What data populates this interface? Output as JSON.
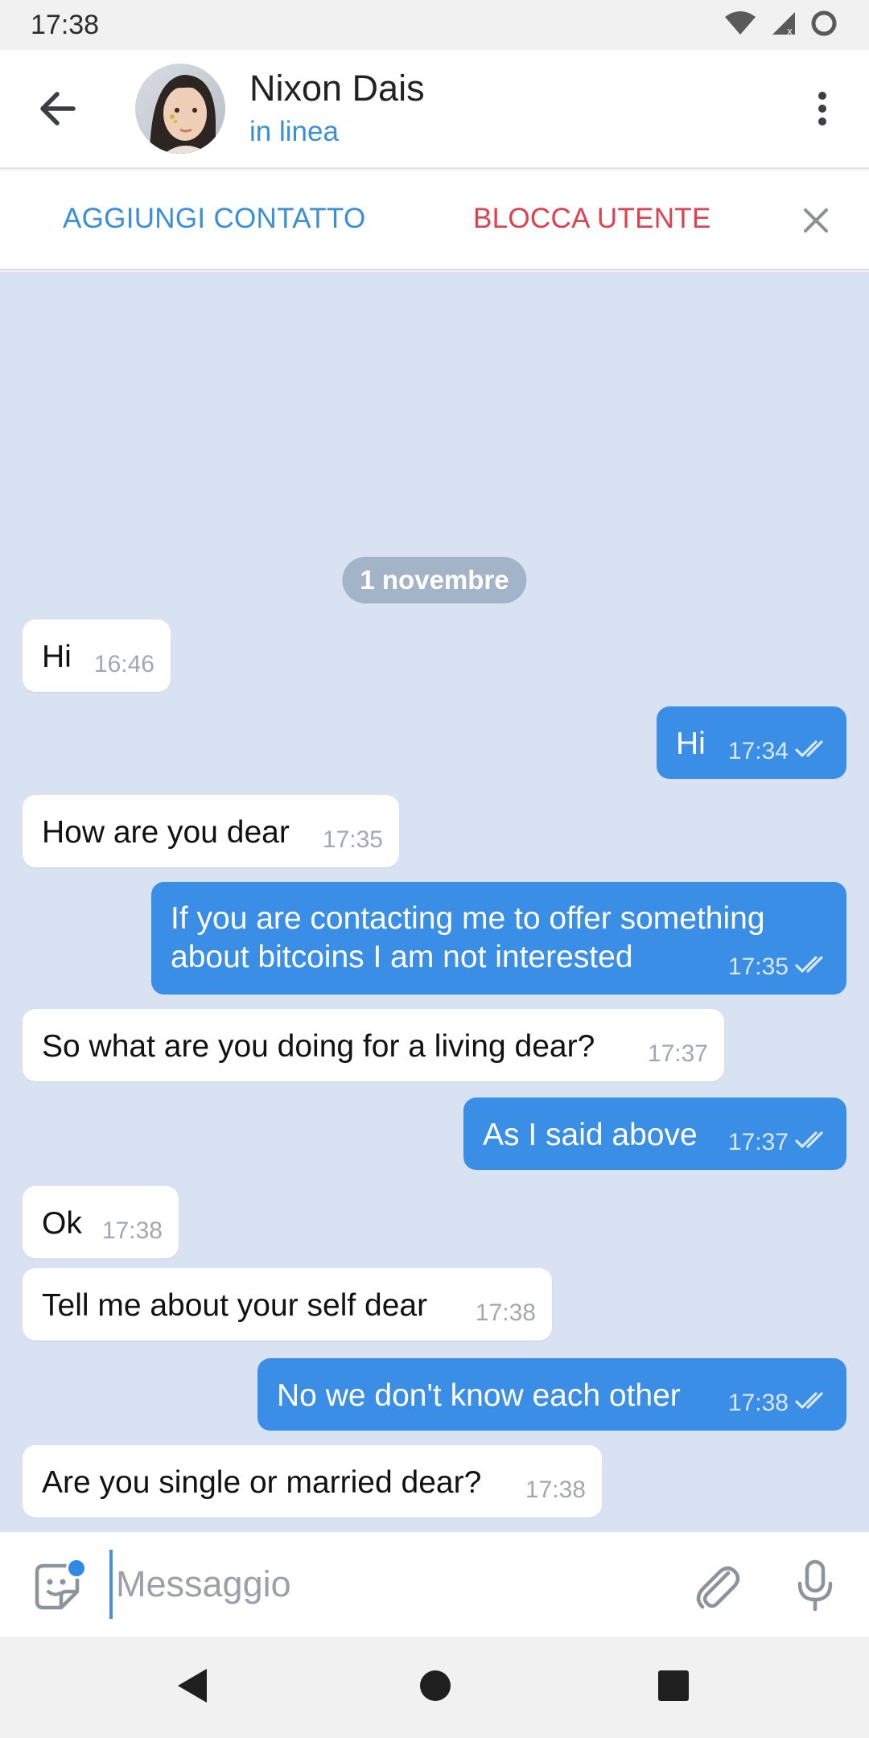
{
  "status_bar": {
    "time": "17:38",
    "icons": [
      "wifi-icon",
      "signal-icon",
      "battery-ring-icon"
    ]
  },
  "header": {
    "name": "Nixon Dais",
    "status": "in linea",
    "back_icon": "arrow-left-icon",
    "menu_icon": "more-vertical-icon"
  },
  "action_bar": {
    "add_contact": "AGGIUNGI CONTATTO",
    "block_user": "BLOCCA UTENTE",
    "close_icon": "close-icon"
  },
  "chat": {
    "date": "1 novembre",
    "messages": [
      {
        "dir": "in",
        "text": "Hi",
        "time": "16:46"
      },
      {
        "dir": "out",
        "text": "Hi",
        "time": "17:34",
        "read": true
      },
      {
        "dir": "in",
        "text": "How are you dear",
        "time": "17:35"
      },
      {
        "dir": "out",
        "text": "If you are contacting me to offer something\nabout bitcoins I am not interested",
        "time": "17:35",
        "read": true
      },
      {
        "dir": "in",
        "text": "So what are you doing for a living dear?",
        "time": "17:37"
      },
      {
        "dir": "out",
        "text": "As I said above",
        "time": "17:37",
        "read": true
      },
      {
        "dir": "in",
        "text": "Ok",
        "time": "17:38"
      },
      {
        "dir": "in",
        "text": "Tell me about your self dear",
        "time": "17:38"
      },
      {
        "dir": "out",
        "text": "No we don't know each other",
        "time": "17:38",
        "read": true
      },
      {
        "dir": "in",
        "text": "Are you single or married dear?",
        "time": "17:38"
      }
    ]
  },
  "input_bar": {
    "placeholder": "Messaggio",
    "value": "",
    "icons": [
      "sticker-icon",
      "paperclip-icon",
      "microphone-icon"
    ]
  },
  "nav_bar": {
    "icons": [
      "nav-back-icon",
      "nav-home-icon",
      "nav-recents-icon"
    ]
  },
  "colors": {
    "accent": "#3a8fd9",
    "danger": "#e0414f",
    "outgoing_bubble": "#3a8ee6",
    "chat_background": "#d8e2f2"
  }
}
